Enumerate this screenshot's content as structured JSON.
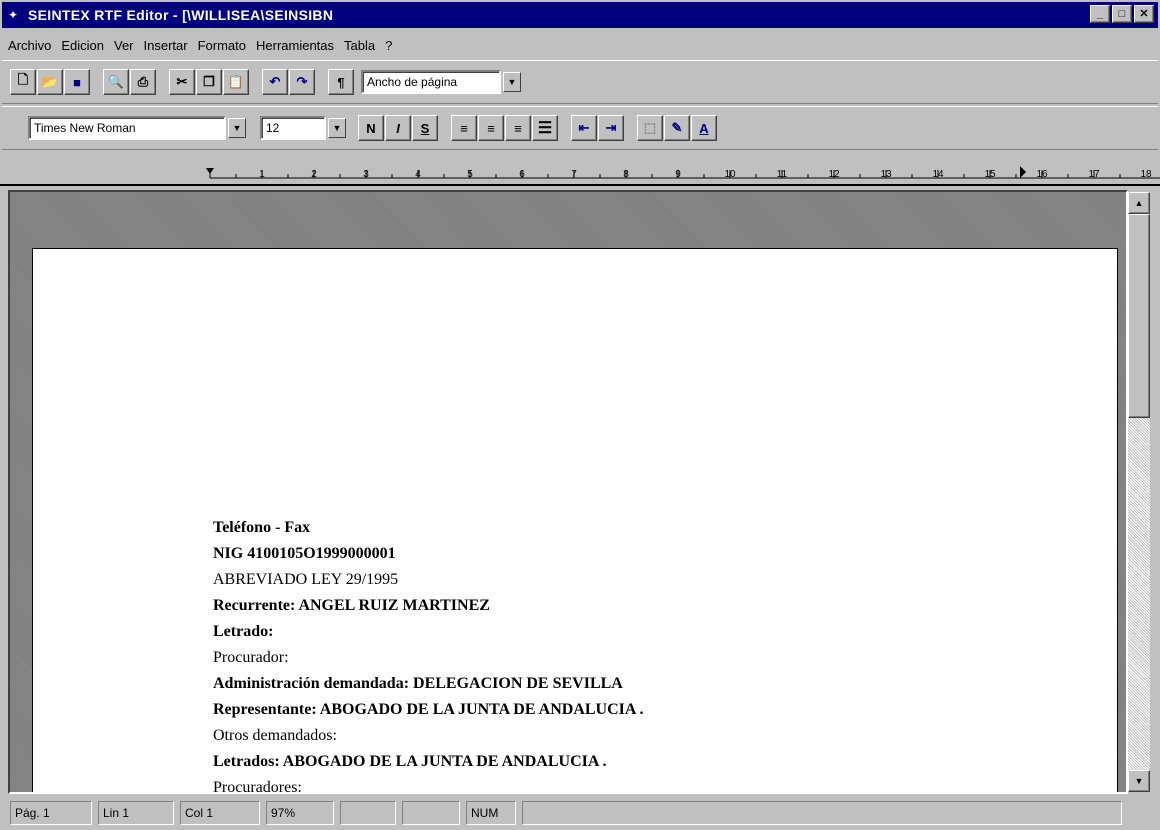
{
  "window": {
    "title": "SEINTEX RTF Editor - [\\WILLISEA\\SEINSIBN"
  },
  "menu": {
    "items": [
      "Archivo",
      "Edicion",
      "Ver",
      "Insertar",
      "Formato",
      "Herramientas",
      "Tabla",
      "?"
    ]
  },
  "toolbar": {
    "zoom_value": "Ancho de página",
    "font_value": "Times New Roman",
    "size_value": "12",
    "bold_label": "N",
    "italic_label": "I",
    "underline_label": "S",
    "paragraph_label": "¶",
    "color_label": "A"
  },
  "ruler": {
    "numbers": [
      "1",
      "2",
      "3",
      "4",
      "5",
      "6",
      "7",
      "8",
      "9",
      "10",
      "11",
      "12",
      "13",
      "14",
      "15",
      "16",
      "17",
      "18"
    ]
  },
  "document": {
    "lines": [
      {
        "text": "Teléfono - Fax",
        "bold": true
      },
      {
        "text": "NIG 4100105O1999000001",
        "bold": true
      },
      {
        "text": "ABREVIADO LEY 29/1995",
        "bold": false
      },
      {
        "text": "Recurrente: ANGEL RUIZ MARTINEZ",
        "bold": true
      },
      {
        "text": "Letrado:",
        "bold": true
      },
      {
        "text": "Procurador:",
        "bold": false
      },
      {
        "text": "Administración demandada: DELEGACION DE SEVILLA",
        "bold": true
      },
      {
        "text": "Representante: ABOGADO DE LA JUNTA DE ANDALUCIA .",
        "bold": true
      },
      {
        "text": "Otros demandados:",
        "bold": false
      },
      {
        "text": "Letrados: ABOGADO DE LA JUNTA DE ANDALUCIA .",
        "bold": true
      },
      {
        "text": "Procuradores:",
        "bold": false
      }
    ]
  },
  "status": {
    "page": "Pág. 1",
    "line": "Lin 1",
    "col": "Col 1",
    "zoom": "97%",
    "num": "NUM"
  }
}
